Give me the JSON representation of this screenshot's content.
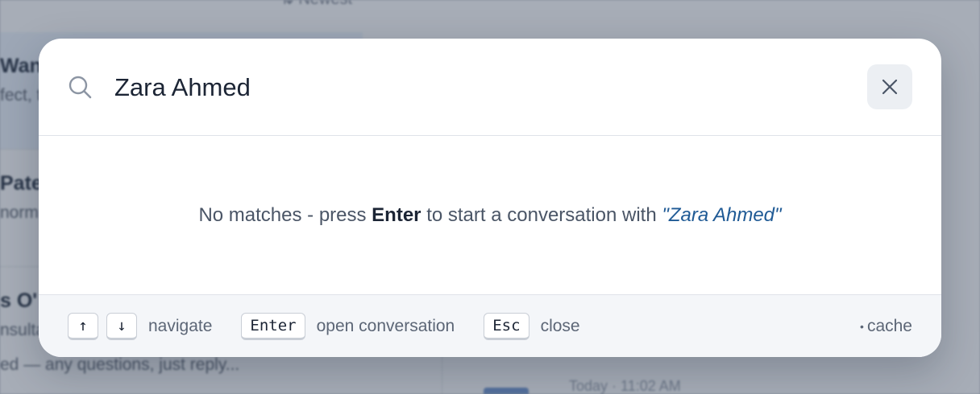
{
  "background": {
    "sort_label": "⇅ Newest",
    "conversations": [
      {
        "name": "Wan",
        "snippet": "fect, t",
        "selected": true
      },
      {
        "name": "Pate",
        "snippet": "norm",
        "selected": false
      },
      {
        "name": "s O'",
        "snippet": "nsulta",
        "selected": false
      }
    ],
    "trailing_snippet": "ed — any questions, just reply...",
    "timestamp": "Today · 11:02 AM"
  },
  "search": {
    "value": "Zara Ahmed",
    "close_icon": "close-icon",
    "search_icon": "search-icon"
  },
  "results": {
    "empty_prefix": "No matches - press ",
    "empty_key": "Enter",
    "empty_middle": " to start a conversation with ",
    "empty_query": "\"Zara Ahmed\""
  },
  "footer": {
    "up_key": "↑",
    "down_key": "↓",
    "navigate_label": "navigate",
    "enter_key": "Enter",
    "open_label": "open conversation",
    "esc_key": "Esc",
    "close_label": "close",
    "cache_label": "cache",
    "cache_dot": "•"
  },
  "colors": {
    "accent": "#1f5a95",
    "overlay": "#465064"
  }
}
